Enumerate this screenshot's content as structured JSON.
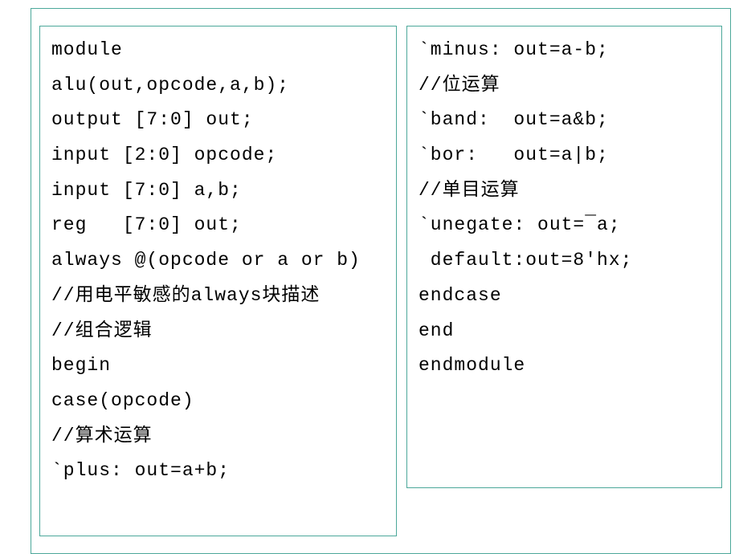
{
  "left": {
    "lines": [
      "module",
      "alu(out,opcode,a,b);",
      "output [7:0] out;",
      "input [2:0] opcode;",
      "input [7:0] a,b;",
      "reg   [7:0] out;",
      "always @(opcode or a or b)",
      "//用电平敏感的always块描述",
      "//组合逻辑",
      "begin",
      "case(opcode)",
      "//算术运算",
      "`plus: out=a+b;"
    ]
  },
  "right": {
    "lines": [
      "`minus: out=a-b;",
      "//位运算",
      "`band:  out=a&b;",
      "`bor:   out=a|b;",
      "//单目运算",
      "`unegate: out=¯a;",
      " default:out=8'hx;",
      "endcase",
      "end",
      "endmodule"
    ]
  }
}
